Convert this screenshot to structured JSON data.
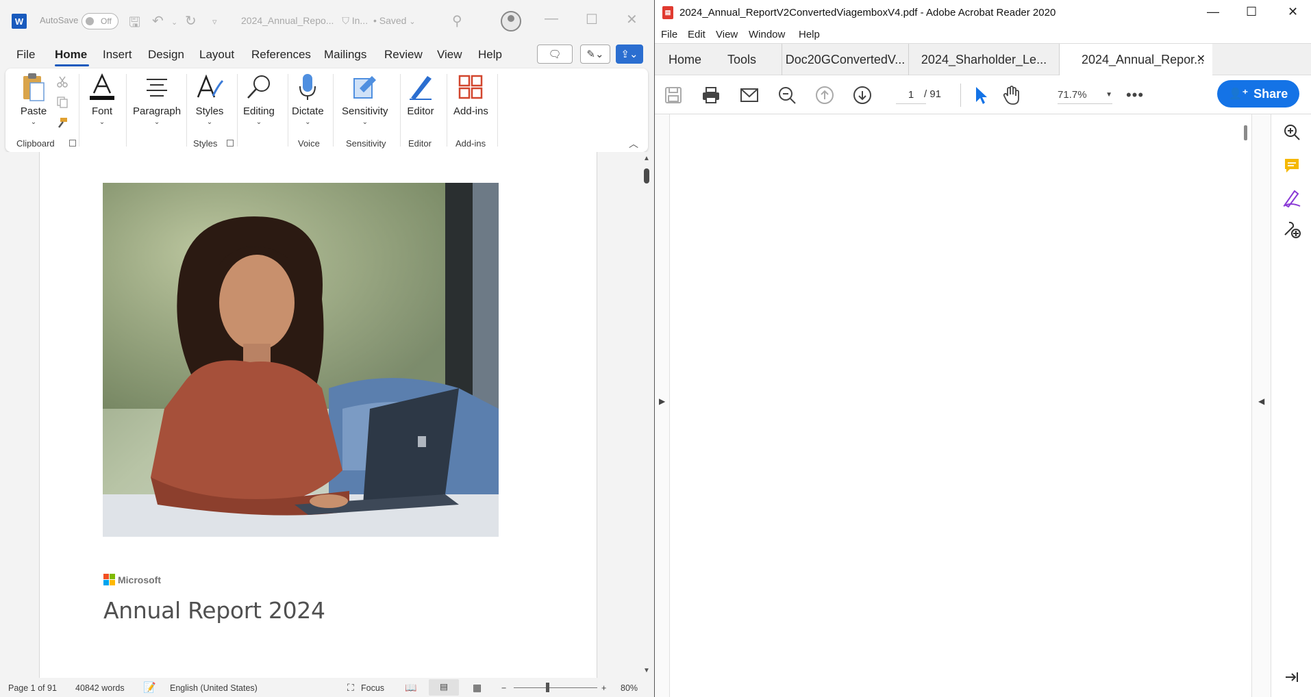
{
  "word": {
    "autosave_label": "AutoSave",
    "autosave_state": "Off",
    "doc_title": "2024_Annual_Repo...",
    "sensitivity_status": "In...",
    "save_status": "• Saved",
    "menu": [
      "File",
      "Home",
      "Insert",
      "Design",
      "Layout",
      "References",
      "Mailings",
      "Review",
      "View",
      "Help"
    ],
    "active_tab": "Home",
    "ribbon": {
      "paste": "Paste",
      "font": "Font",
      "paragraph": "Paragraph",
      "styles": "Styles",
      "editing": "Editing",
      "dictate": "Dictate",
      "sensitivity": "Sensitivity",
      "editor": "Editor",
      "addins": "Add-ins",
      "groups": {
        "clipboard": "Clipboard",
        "styles": "Styles",
        "voice": "Voice",
        "sensitivity": "Sensitivity",
        "editor": "Editor",
        "addins": "Add-ins"
      }
    },
    "document": {
      "brand": "Microsoft",
      "title": "Annual Report 2024"
    },
    "status": {
      "page": "Page 1 of 91",
      "words": "40842 words",
      "language": "English (United States)",
      "focus": "Focus",
      "zoom": "80%"
    },
    "accent": "#185abd"
  },
  "acrobat": {
    "window_title": "2024_Annual_ReportV2ConvertedViagemboxV4.pdf - Adobe Acrobat Reader 2020",
    "menu": [
      "File",
      "Edit",
      "View",
      "Window",
      "Help"
    ],
    "tabs": {
      "home": "Home",
      "tools": "Tools",
      "docs": [
        "Doc20GConvertedV...",
        "2024_Sharholder_Le...",
        "2024_Annual_Repor..."
      ],
      "active_index": 2
    },
    "toolbar": {
      "current_page": "1",
      "page_total": "/ 91",
      "zoom": "71.7%",
      "share": "Share"
    },
    "accent": "#1473e6"
  }
}
